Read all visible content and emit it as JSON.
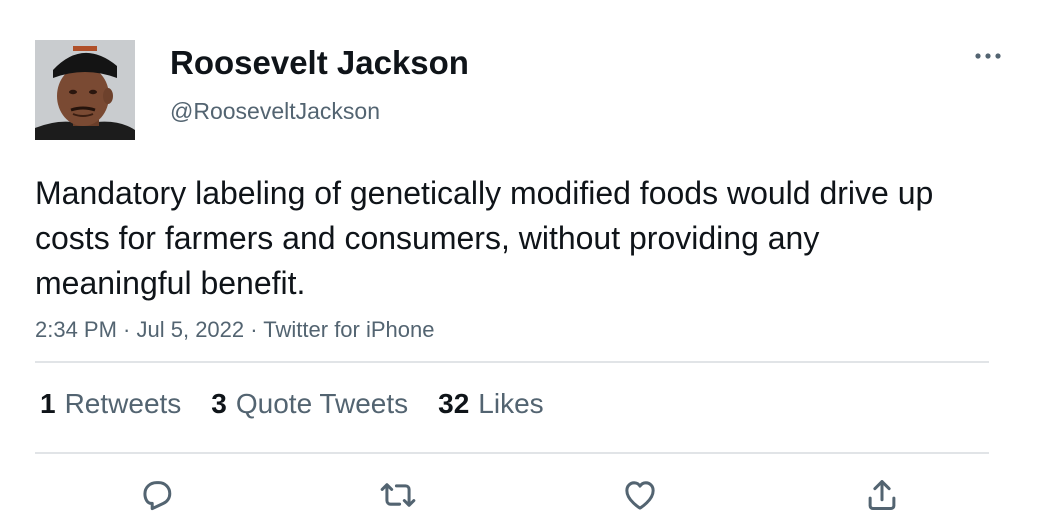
{
  "author": {
    "display_name": "Roosevelt Jackson",
    "handle": "@RooseveltJackson",
    "avatar_icon": "profile-photo"
  },
  "tweet": {
    "text": "Mandatory labeling of genetically modified foods would drive up costs for farmers and consumers, without providing any meaningful benefit.",
    "time": "2:34 PM",
    "separator": " · ",
    "date": "Jul 5, 2022",
    "source": "Twitter for iPhone"
  },
  "stats": {
    "retweets": {
      "count": "1",
      "label": "Retweets"
    },
    "quote_tweets": {
      "count": "3",
      "label": "Quote Tweets"
    },
    "likes": {
      "count": "32",
      "label": "Likes"
    }
  },
  "icons": {
    "more": "more-horizontal-icon",
    "reply": "reply-icon",
    "retweet": "retweet-icon",
    "like": "heart-icon",
    "share": "share-icon"
  },
  "colors": {
    "text_primary": "#0f1419",
    "text_secondary": "#536471",
    "divider": "#e1e4e7"
  }
}
